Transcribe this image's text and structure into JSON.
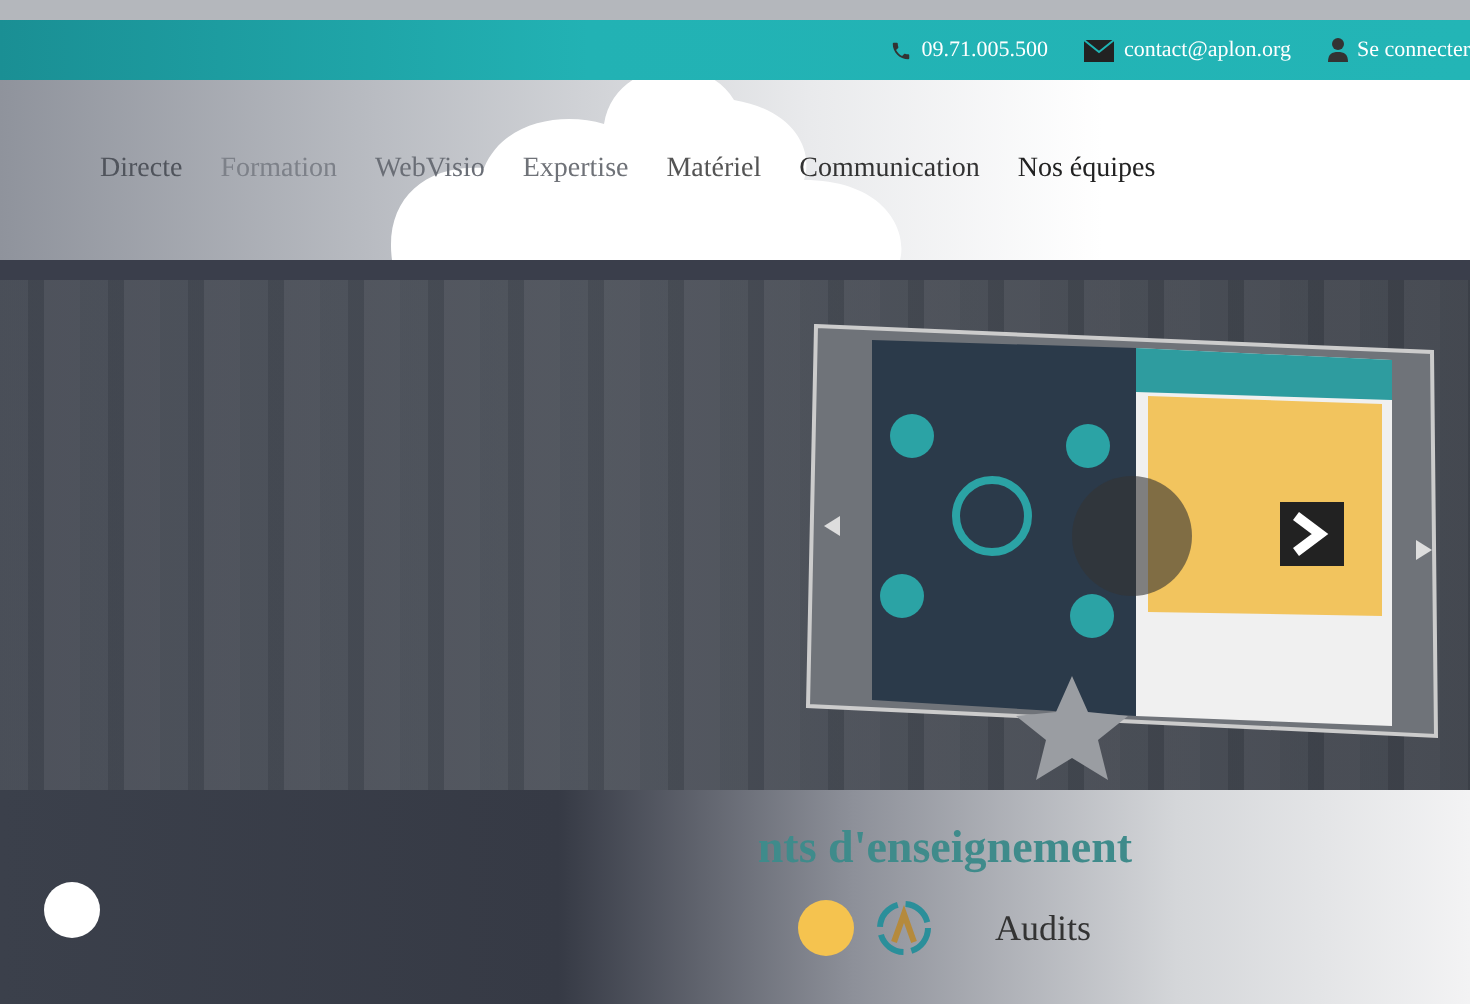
{
  "top_bar": {
    "phone": "09.71.005.500",
    "email": "contact@aplon.org",
    "login": "Se connecter"
  },
  "nav": {
    "items": [
      {
        "label": "Directe"
      },
      {
        "label": "Formation"
      },
      {
        "label": "WebVisio"
      },
      {
        "label": "Expertise"
      },
      {
        "label": "Matériel"
      },
      {
        "label": "Communication"
      },
      {
        "label": "Nos équipes"
      }
    ]
  },
  "section": {
    "heading": "nts d'enseignement",
    "items": [
      {
        "label": "Audits"
      }
    ]
  }
}
